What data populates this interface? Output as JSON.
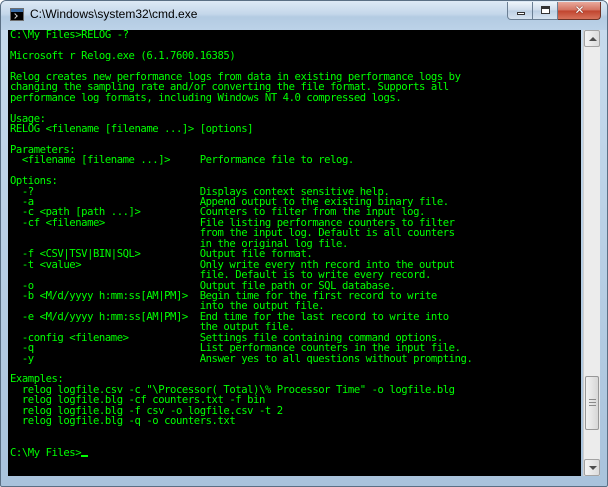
{
  "window": {
    "title": "C:\\Windows\\system32\\cmd.exe",
    "app_icon": "console-icon",
    "caption_buttons": {
      "minimize": "minimize-icon",
      "maximize": "maximize-icon",
      "close": "close-icon",
      "close_glyph": "✕"
    }
  },
  "colors": {
    "console_bg": "#000000",
    "console_text": "#00ff00"
  },
  "console": {
    "lines": [
      "C:\\My Files>RELOG -?",
      "",
      "Microsoft r Relog.exe (6.1.7600.16385)",
      "",
      "Relog creates new performance logs from data in existing performance logs by",
      "changing the sampling rate and/or converting the file format. Supports all",
      "performance log formats, including Windows NT 4.0 compressed logs.",
      "",
      "Usage:",
      "RELOG <filename [filename ...]> [options]",
      "",
      "Parameters:",
      "  <filename [filename ...]>     Performance file to relog.",
      "",
      "Options:",
      "  -?                            Displays context sensitive help.",
      "  -a                            Append output to the existing binary file.",
      "  -c <path [path ...]>          Counters to filter from the input log.",
      "  -cf <filename>                File listing performance counters to filter",
      "                                from the input log. Default is all counters",
      "                                in the original log file.",
      "  -f <CSV|TSV|BIN|SQL>          Output file format.",
      "  -t <value>                    Only write every nth record into the output",
      "                                file. Default is to write every record.",
      "  -o                            Output file path or SQL database.",
      "  -b <M/d/yyyy h:mm:ss[AM|PM]>  Begin time for the first record to write",
      "                                into the output file.",
      "  -e <M/d/yyyy h:mm:ss[AM|PM]>  End time for the last record to write into",
      "                                the output file.",
      "  -config <filename>            Settings file containing command options.",
      "  -q                            List performance counters in the input file.",
      "  -y                            Answer yes to all questions without prompting.",
      "",
      "Examples:",
      "  relog logfile.csv -c \"\\Processor(_Total)\\% Processor Time\" -o logfile.blg",
      "  relog logfile.blg -cf counters.txt -f bin",
      "  relog logfile.blg -f csv -o logfile.csv -t 2",
      "  relog logfile.blg -q -o counters.txt",
      "",
      "",
      "C:\\My Files>"
    ]
  },
  "scrollbar": {
    "up_icon": "scroll-up-arrow-icon",
    "down_icon": "scroll-down-arrow-icon",
    "position": 0.92
  }
}
